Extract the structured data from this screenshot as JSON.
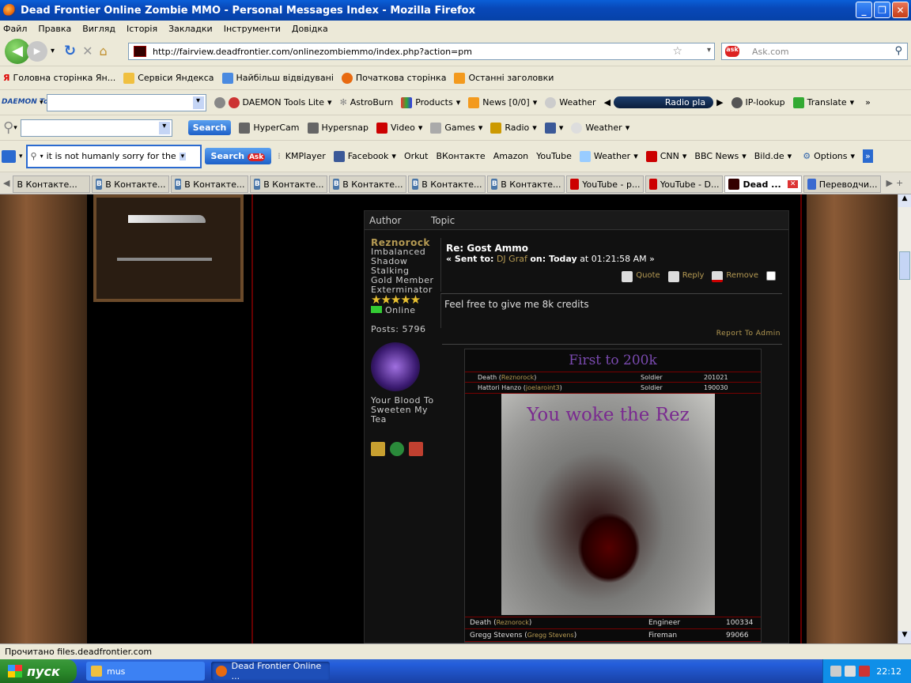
{
  "window": {
    "title": "Dead Frontier Online Zombie MMO - Personal Messages Index - Mozilla Firefox"
  },
  "menu": [
    "Файл",
    "Правка",
    "Вигляд",
    "Історія",
    "Закладки",
    "Інструменти",
    "Довідка"
  ],
  "url": "http://fairview.deadfrontier.com/onlinezombiemmo/index.php?action=pm",
  "ask_placeholder": "Ask.com",
  "bookmarks": [
    "Головна сторінка Ян...",
    "Сервіси Яндекса",
    "Найбільш відвідувані",
    "Початкова сторінка",
    "Останні заголовки"
  ],
  "daemon": {
    "logo": "DAEMON Tools",
    "items": [
      "DAEMON Tools Lite",
      "AstroBurn",
      "Products",
      "News [0/0]",
      "Weather"
    ],
    "radio": "Radio pla",
    "tail": [
      "IP-lookup",
      "Translate"
    ]
  },
  "search2": {
    "button": "Search",
    "items": [
      "HyperCam",
      "Hypersnap",
      "Video",
      "Games",
      "Radio",
      "Weather"
    ]
  },
  "askbar": {
    "query": "it is not humanly sorry for the mist",
    "button": "Search",
    "items": [
      "KMPlayer",
      "Facebook",
      "Orkut",
      "ВКонтакте",
      "Amazon",
      "YouTube",
      "Weather",
      "CNN",
      "BBC News",
      "Bild.de"
    ],
    "options": "Options"
  },
  "tabs": [
    "В Контакте...",
    "В Контакте...",
    "В Контакте...",
    "В Контакте...",
    "В Контакте...",
    "В Контакте...",
    "В Контакте...",
    "YouTube - p...",
    "YouTube - D...",
    "Dead ...",
    "Переводчи..."
  ],
  "forum": {
    "col_author": "Author",
    "col_topic": "Topic",
    "author": {
      "name": "Reznorock",
      "title": [
        "Imbalanced",
        "Shadow",
        "Stalking",
        "Gold Member",
        "Exterminator"
      ],
      "status": "Online",
      "posts": "Posts: 5796",
      "motto": [
        "Your Blood To",
        "Sweeten My",
        "Tea"
      ]
    },
    "subject": "Re: Gost Ammo",
    "sent_prefix": "« Sent to:",
    "sent_to": "DJ Graf",
    "sent_on": "on: Today",
    "sent_time": "at 01:21:58 AM »",
    "actions": {
      "quote": "Quote",
      "reply": "Reply",
      "remove": "Remove"
    },
    "body": "Feel free to give me 8k credits",
    "report": "Report To Admin",
    "sig": {
      "banner": "First to 200k",
      "top_rows": [
        [
          "Death",
          "Reznorock",
          "Soldier",
          "201021"
        ],
        [
          "Hattori Hanzo",
          "joelaroint3",
          "Soldier",
          "190030"
        ]
      ],
      "image_caption": "You woke the Rez",
      "bottom_rows": [
        [
          "Death",
          "Reznorock",
          "Engineer",
          "100334"
        ],
        [
          "Gregg Stevens",
          "Gregg Stevens",
          "Fireman",
          "99066"
        ]
      ]
    }
  },
  "status": "Прочитано files.deadfrontier.com",
  "taskbar": {
    "start": "пуск",
    "tasks": [
      "mus",
      "Dead Frontier Online ..."
    ],
    "time": "22:12"
  }
}
